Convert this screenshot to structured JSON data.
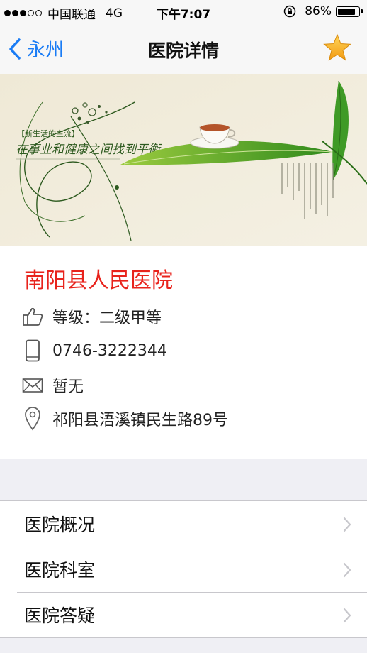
{
  "status_bar": {
    "carrier": "中国联通",
    "network": "4G",
    "time": "下午7:07",
    "battery_percent": "86%",
    "battery_level": 0.86,
    "signal_bars_filled": 3,
    "signal_bars_total": 5
  },
  "nav": {
    "back_label": "永州",
    "title": "医院详情",
    "favorite_icon": "star-icon"
  },
  "banner": {
    "tag_text": "【新生活的主流】",
    "slogan": "在事业和健康之间找到平衡"
  },
  "hospital": {
    "name": "南阳县人民医院",
    "grade": "等级：二级甲等",
    "phone": "0746-3222344",
    "email": "暂无",
    "address": "祁阳县浯溪镇民生路89号"
  },
  "menu": {
    "items": [
      {
        "label": "医院概况"
      },
      {
        "label": "医院科室"
      },
      {
        "label": "医院答疑"
      }
    ]
  },
  "colors": {
    "accent": "#1a7cf5",
    "hospital_name": "#e8231c",
    "star": "#f5a623",
    "background": "#efeff4"
  }
}
